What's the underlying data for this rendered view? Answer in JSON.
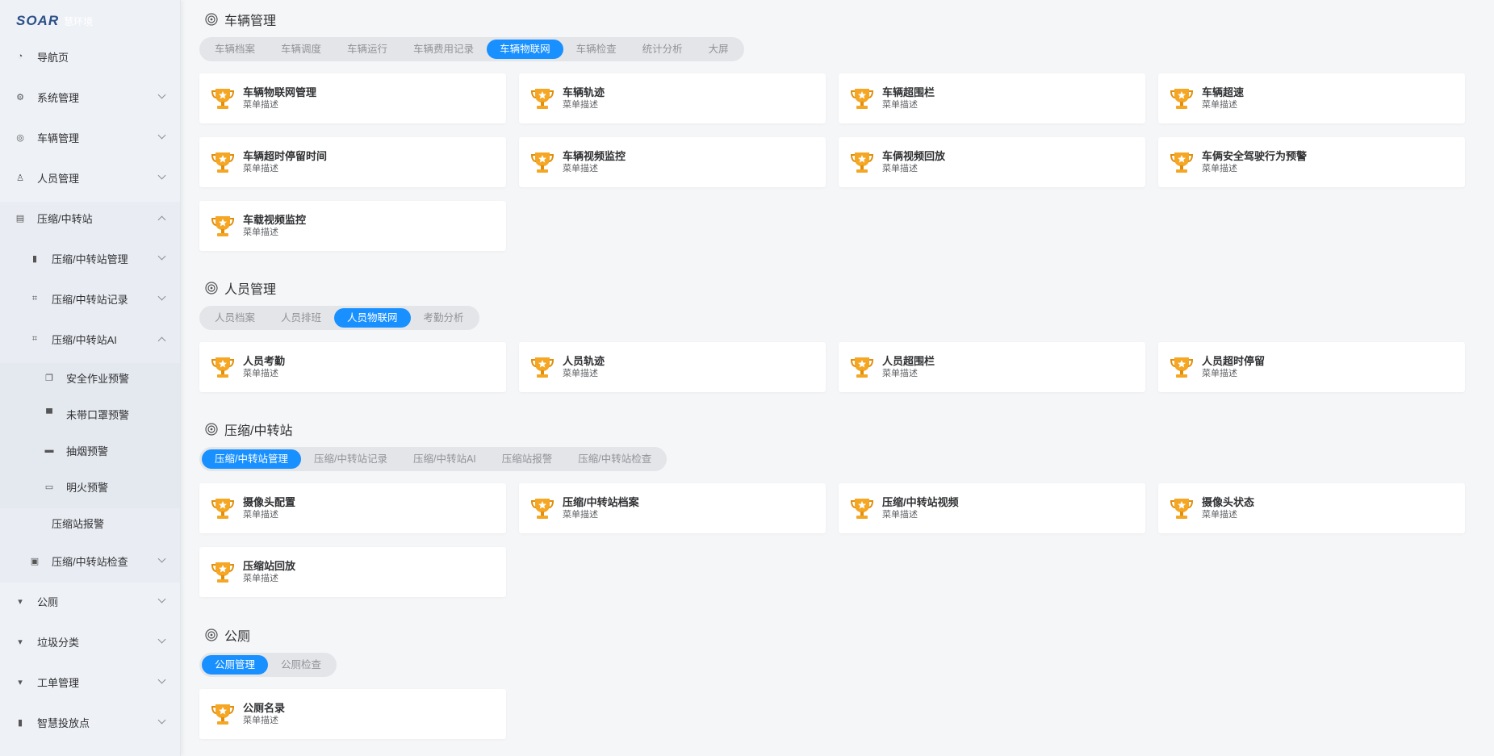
{
  "app": {
    "logo_mark": "SOAR",
    "logo_text": "慧环境"
  },
  "sidebar": {
    "items": [
      {
        "label": "导航页",
        "icon": "dashboard-icon",
        "level": 1,
        "chevron": ""
      },
      {
        "label": "系统管理",
        "icon": "gear-icon",
        "level": 1,
        "chevron": "down"
      },
      {
        "label": "车辆管理",
        "icon": "steering-wheel-icon",
        "level": 1,
        "chevron": "down"
      },
      {
        "label": "人员管理",
        "icon": "user-icon",
        "level": 1,
        "chevron": "down"
      },
      {
        "label": "压缩/中转站",
        "icon": "station-icon",
        "level": 1,
        "chevron": "up"
      },
      {
        "label": "压缩/中转站管理",
        "icon": "info-icon",
        "level": 2,
        "chevron": "down"
      },
      {
        "label": "压缩/中转站记录",
        "icon": "record-icon",
        "level": 2,
        "chevron": "down"
      },
      {
        "label": "压缩/中转站AI",
        "icon": "ai-icon",
        "level": 2,
        "chevron": "up"
      },
      {
        "label": "安全作业预警",
        "icon": "copy-icon",
        "level": 3,
        "chevron": ""
      },
      {
        "label": "未带口罩预警",
        "icon": "monitor-icon",
        "level": 3,
        "chevron": ""
      },
      {
        "label": "抽烟预警",
        "icon": "card-icon",
        "level": 3,
        "chevron": ""
      },
      {
        "label": "明火预警",
        "icon": "window-icon",
        "level": 3,
        "chevron": ""
      },
      {
        "label": "压缩站报警",
        "icon": "",
        "level": 2,
        "chevron": ""
      },
      {
        "label": "压缩/中转站检查",
        "icon": "check-box-icon",
        "level": 2,
        "chevron": "down"
      },
      {
        "label": "公厕",
        "icon": "trash-icon",
        "level": 1,
        "chevron": "down"
      },
      {
        "label": "垃圾分类",
        "icon": "trash-icon",
        "level": 1,
        "chevron": "down"
      },
      {
        "label": "工单管理",
        "icon": "trash-icon",
        "level": 1,
        "chevron": "down"
      },
      {
        "label": "智慧投放点",
        "icon": "bin-icon",
        "level": 1,
        "chevron": "down"
      }
    ]
  },
  "sections": [
    {
      "title": "车辆管理",
      "tabs": [
        "车辆档案",
        "车辆调度",
        "车辆运行",
        "车辆费用记录",
        "车辆物联网",
        "车辆检查",
        "统计分析",
        "大屏"
      ],
      "active_tab": 4,
      "cards": [
        {
          "title": "车辆物联网管理",
          "desc": "菜单描述"
        },
        {
          "title": "车辆轨迹",
          "desc": "菜单描述"
        },
        {
          "title": "车辆超围栏",
          "desc": "菜单描述"
        },
        {
          "title": "车辆超速",
          "desc": "菜单描述"
        },
        {
          "title": "车辆超时停留时间",
          "desc": "菜单描述"
        },
        {
          "title": "车辆视频监控",
          "desc": "菜单描述"
        },
        {
          "title": "车俩视频回放",
          "desc": "菜单描述"
        },
        {
          "title": "车俩安全驾驶行为预警",
          "desc": "菜单描述"
        },
        {
          "title": "车载视频监控",
          "desc": "菜单描述"
        }
      ]
    },
    {
      "title": "人员管理",
      "tabs": [
        "人员档案",
        "人员排班",
        "人员物联网",
        "考勤分析"
      ],
      "active_tab": 2,
      "cards": [
        {
          "title": "人员考勤",
          "desc": "菜单描述"
        },
        {
          "title": "人员轨迹",
          "desc": "菜单描述"
        },
        {
          "title": "人员超围栏",
          "desc": "菜单描述"
        },
        {
          "title": "人员超时停留",
          "desc": "菜单描述"
        }
      ]
    },
    {
      "title": "压缩/中转站",
      "tabs": [
        "压缩/中转站管理",
        "压缩/中转站记录",
        "压缩/中转站AI",
        "压缩站报警",
        "压缩/中转站检查"
      ],
      "active_tab": 0,
      "cards": [
        {
          "title": "摄像头配置",
          "desc": "菜单描述"
        },
        {
          "title": "压缩/中转站档案",
          "desc": "菜单描述"
        },
        {
          "title": "压缩/中转站视频",
          "desc": "菜单描述"
        },
        {
          "title": "摄像头状态",
          "desc": "菜单描述"
        },
        {
          "title": "压缩站回放",
          "desc": "菜单描述"
        }
      ]
    },
    {
      "title": "公厕",
      "tabs": [
        "公厕管理",
        "公厕检查"
      ],
      "active_tab": 0,
      "cards": [
        {
          "title": "公厕名录",
          "desc": "菜单描述"
        }
      ]
    }
  ],
  "colors": {
    "accent": "#1890ff",
    "trophy": "#f5a623",
    "trophy_dark": "#e08e0b"
  }
}
